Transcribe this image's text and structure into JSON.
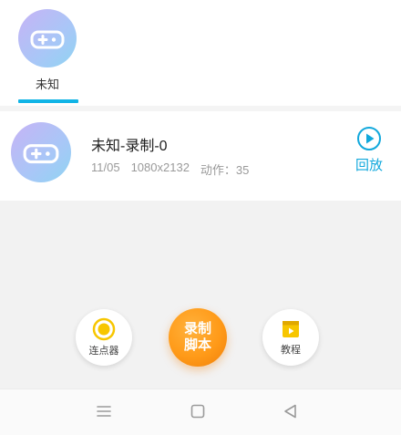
{
  "tabs": [
    {
      "label": "未知",
      "icon": "gamepad-icon",
      "selected": true
    }
  ],
  "record": {
    "title": "未知-录制-0",
    "date": "11/05",
    "resolution": "1080x2132",
    "actions": "动作：35",
    "replay_label": "回放"
  },
  "fabs": {
    "clicker_label": "连点器",
    "record_label": "录制\n脚本",
    "tutorial_label": "教程"
  },
  "navbar": {
    "icons": [
      "menu-icon",
      "home-icon",
      "back-icon"
    ]
  },
  "colors": {
    "accent": "#11b4e6",
    "record_orange": "#ff9a18",
    "clicker_yellow": "#f7c600"
  }
}
